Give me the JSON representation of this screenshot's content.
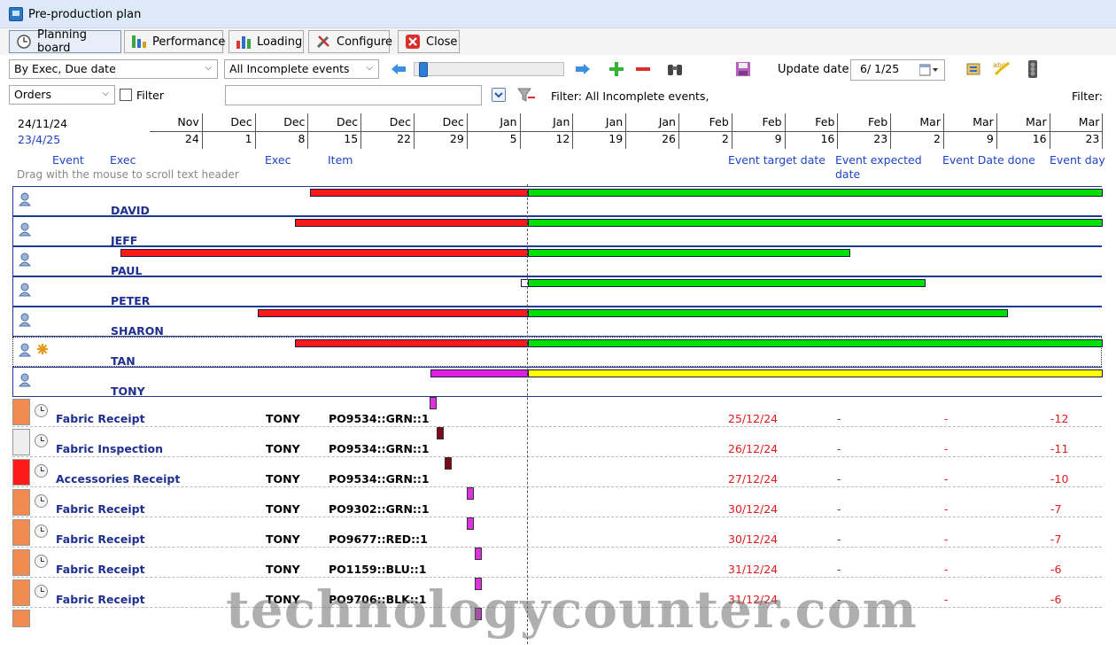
{
  "window": {
    "title": "Pre-production plan"
  },
  "toolbar": {
    "planning_board": "Planning board",
    "performance": "Performance",
    "loading": "Loading",
    "configure": "Configure",
    "close": "Close"
  },
  "filters": {
    "group_by": "By Exec, Due date",
    "event_filter": "All Incomplete events",
    "update_date_label": "Update date",
    "update_date_value": "6/ 1/25",
    "object_type": "Orders",
    "filter_checkbox_label": "Filter",
    "search_value": "",
    "filter_status": "Filter: All Incomplete events,",
    "filter_right": "Filter:"
  },
  "timeline": {
    "range_start": "24/11/24",
    "range_end": "23/4/25",
    "columns": [
      {
        "month": "Nov",
        "day": "24"
      },
      {
        "month": "Dec",
        "day": "1"
      },
      {
        "month": "Dec",
        "day": "8"
      },
      {
        "month": "Dec",
        "day": "15"
      },
      {
        "month": "Dec",
        "day": "22"
      },
      {
        "month": "Dec",
        "day": "29"
      },
      {
        "month": "Jan",
        "day": "5"
      },
      {
        "month": "Jan",
        "day": "12"
      },
      {
        "month": "Jan",
        "day": "19"
      },
      {
        "month": "Jan",
        "day": "26"
      },
      {
        "month": "Feb",
        "day": "2"
      },
      {
        "month": "Feb",
        "day": "9"
      },
      {
        "month": "Feb",
        "day": "16"
      },
      {
        "month": "Feb",
        "day": "23"
      },
      {
        "month": "Mar",
        "day": "2"
      },
      {
        "month": "Mar",
        "day": "9"
      },
      {
        "month": "Mar",
        "day": "16"
      },
      {
        "month": "Mar",
        "day": "23"
      }
    ]
  },
  "headers": {
    "event": "Event",
    "exec1": "Exec",
    "drag_hint": "Drag with the mouse to scroll text header",
    "exec2": "Exec",
    "item": "Item",
    "target": "Event target date",
    "expected_1": "Event expected",
    "expected_2": "date",
    "done": "Event Date done",
    "days": "Event day"
  },
  "groups": [
    {
      "name": "DAVID"
    },
    {
      "name": "JEFF"
    },
    {
      "name": "PAUL"
    },
    {
      "name": "PETER"
    },
    {
      "name": "SHARON"
    },
    {
      "name": "TAN"
    },
    {
      "name": "TONY"
    }
  ],
  "events": [
    {
      "event": "Fabric Receipt",
      "exec": "TONY",
      "item": "PO9534::GRN::1",
      "target": "25/12/24",
      "expected": "-",
      "done": "-",
      "days": "-12",
      "swatch": "#f28b50",
      "mark": "#dd33dd"
    },
    {
      "event": "Fabric Inspection",
      "exec": "TONY",
      "item": "PO9534::GRN::1",
      "target": "26/12/24",
      "expected": "-",
      "done": "-",
      "days": "-11",
      "swatch": "#eeeeee",
      "mark": "#7a0a1a"
    },
    {
      "event": "Accessories Receipt",
      "exec": "TONY",
      "item": "PO9534::GRN::1",
      "target": "27/12/24",
      "expected": "-",
      "done": "-",
      "days": "-10",
      "swatch": "#ff1a1a",
      "mark": "#7a0a1a"
    },
    {
      "event": "Fabric Receipt",
      "exec": "TONY",
      "item": "PO9302::GRN::1",
      "target": "30/12/24",
      "expected": "-",
      "done": "-",
      "days": "-7",
      "swatch": "#f28b50",
      "mark": "#dd33dd"
    },
    {
      "event": "Fabric Receipt",
      "exec": "TONY",
      "item": "PO9677::RED::1",
      "target": "30/12/24",
      "expected": "-",
      "done": "-",
      "days": "-7",
      "swatch": "#f28b50",
      "mark": "#dd33dd"
    },
    {
      "event": "Fabric Receipt",
      "exec": "TONY",
      "item": "PO1159::BLU::1",
      "target": "31/12/24",
      "expected": "-",
      "done": "-",
      "days": "-6",
      "swatch": "#f28b50",
      "mark": "#dd33dd"
    },
    {
      "event": "Fabric Receipt",
      "exec": "TONY",
      "item": "PO9706::BLK::1",
      "target": "31/12/24",
      "expected": "-",
      "done": "-",
      "days": "-6",
      "swatch": "#f28b50",
      "mark": "#dd33dd"
    }
  ],
  "colors": {
    "late_bar": "#ff1a1a",
    "on_time_bar": "#00e000",
    "pending_bar": "#e020e0",
    "future_bar": "#ffff00",
    "header_text": "#1e43c6"
  },
  "watermark": "technologycounter.com"
}
